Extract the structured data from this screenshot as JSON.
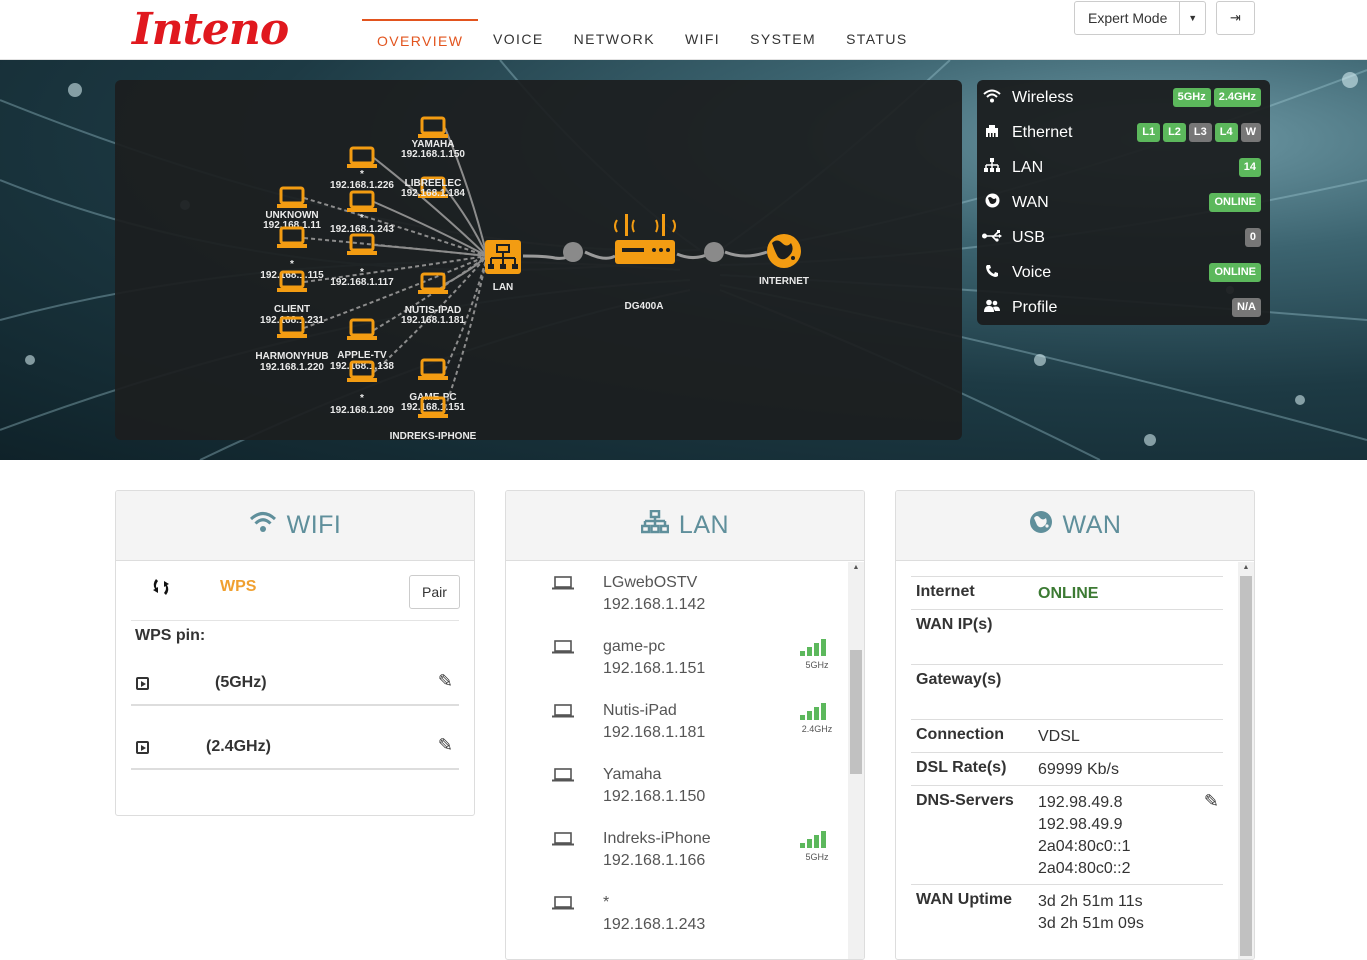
{
  "app": {
    "logo": "Inteno"
  },
  "nav": {
    "items": [
      {
        "label": "OVERVIEW",
        "active": true
      },
      {
        "label": "VOICE",
        "active": false
      },
      {
        "label": "NETWORK",
        "active": false
      },
      {
        "label": "WIFI",
        "active": false
      },
      {
        "label": "SYSTEM",
        "active": false
      },
      {
        "label": "STATUS",
        "active": false
      }
    ]
  },
  "toolbar": {
    "mode_label": "Expert Mode",
    "logout_icon": "logout-icon"
  },
  "topology": {
    "lan_label": "LAN",
    "router_label": "DG400A",
    "internet_label": "INTERNET",
    "hosts": [
      {
        "name": "YAMAHA",
        "ip": "192.168.1.150"
      },
      {
        "name": "*",
        "ip": "192.168.1.226"
      },
      {
        "name": "LIBREELEC",
        "ip": "192.168.1.184"
      },
      {
        "name": "UNKNOWN",
        "ip": "192.168.1.11"
      },
      {
        "name": "*",
        "ip": "192.168.1.243"
      },
      {
        "name": "*",
        "ip": "192.168.1.115"
      },
      {
        "name": "*",
        "ip": "192.168.1.117"
      },
      {
        "name": "CLIENT",
        "ip": "192.168.1.231"
      },
      {
        "name": "NUTIS-IPAD",
        "ip": "192.168.1.181"
      },
      {
        "name": "HARMONYHUB",
        "ip": "192.168.1.220"
      },
      {
        "name": "APPLE-TV",
        "ip": "192.168.1.138"
      },
      {
        "name": "*",
        "ip": "192.168.1.209"
      },
      {
        "name": "GAME-PC",
        "ip": "192.168.1.151"
      },
      {
        "name": "INDREKS-IPHONE",
        "ip": ""
      }
    ]
  },
  "status": {
    "rows": [
      {
        "icon": "wifi-icon",
        "label": "Wireless",
        "badges": [
          {
            "text": "5GHz",
            "color": "green"
          },
          {
            "text": "2.4GHz",
            "color": "green"
          }
        ]
      },
      {
        "icon": "ethernet-icon",
        "label": "Ethernet",
        "badges": [
          {
            "text": "L1",
            "color": "green"
          },
          {
            "text": "L2",
            "color": "green"
          },
          {
            "text": "L3",
            "color": "gray"
          },
          {
            "text": "L4",
            "color": "green"
          },
          {
            "text": "W",
            "color": "gray"
          }
        ]
      },
      {
        "icon": "sitemap-icon",
        "label": "LAN",
        "badges": [
          {
            "text": "14",
            "color": "green"
          }
        ]
      },
      {
        "icon": "globe-icon",
        "label": "WAN",
        "badges": [
          {
            "text": "ONLINE",
            "color": "green"
          }
        ]
      },
      {
        "icon": "usb-icon",
        "label": "USB",
        "badges": [
          {
            "text": "0",
            "color": "gray"
          }
        ]
      },
      {
        "icon": "phone-icon",
        "label": "Voice",
        "badges": [
          {
            "text": "ONLINE",
            "color": "green"
          }
        ]
      },
      {
        "icon": "users-icon",
        "label": "Profile",
        "badges": [
          {
            "text": "N/A",
            "color": "gray"
          }
        ]
      }
    ]
  },
  "wifi_panel": {
    "title": "WIFI",
    "wps_label": "WPS",
    "pair_button": "Pair",
    "wps_pin_label": "WPS pin:",
    "networks": [
      {
        "band": "(5GHz)"
      },
      {
        "band": "(2.4GHz)"
      }
    ]
  },
  "lan_panel": {
    "title": "LAN",
    "clients": [
      {
        "name": "LGwebOSTV",
        "ip": "192.168.1.142",
        "band": "",
        "signal": 0
      },
      {
        "name": "game-pc",
        "ip": "192.168.1.151",
        "band": "5GHz",
        "signal": 4
      },
      {
        "name": "Nutis-iPad",
        "ip": "192.168.1.181",
        "band": "2.4GHz",
        "signal": 4
      },
      {
        "name": "Yamaha",
        "ip": "192.168.1.150",
        "band": "",
        "signal": 0
      },
      {
        "name": "Indreks-iPhone",
        "ip": "192.168.1.166",
        "band": "5GHz",
        "signal": 4
      },
      {
        "name": "*",
        "ip": "192.168.1.243",
        "band": "",
        "signal": 0
      }
    ]
  },
  "wan_panel": {
    "title": "WAN",
    "rows": [
      {
        "key": "Internet",
        "value": [
          "ONLINE"
        ],
        "online": true
      },
      {
        "key": "WAN IP(s)",
        "value": []
      },
      {
        "key": "Gateway(s)",
        "value": []
      },
      {
        "key": "Connection",
        "value": [
          "VDSL"
        ]
      },
      {
        "key": "DSL Rate(s)",
        "value": [
          "69999 Kb/s"
        ]
      },
      {
        "key": "DNS-Servers",
        "value": [
          "192.98.49.8",
          "192.98.49.9",
          "2a04:80c0::1",
          "2a04:80c0::2"
        ],
        "editable": true
      },
      {
        "key": "WAN Uptime",
        "value": [
          "3d 2h 51m 11s",
          "3d 2h 51m 09s"
        ]
      }
    ]
  },
  "colors": {
    "accent": "#e2541e",
    "device": "#f39c12",
    "online": "#5cb85c",
    "panel_title": "#5f8f9b"
  }
}
